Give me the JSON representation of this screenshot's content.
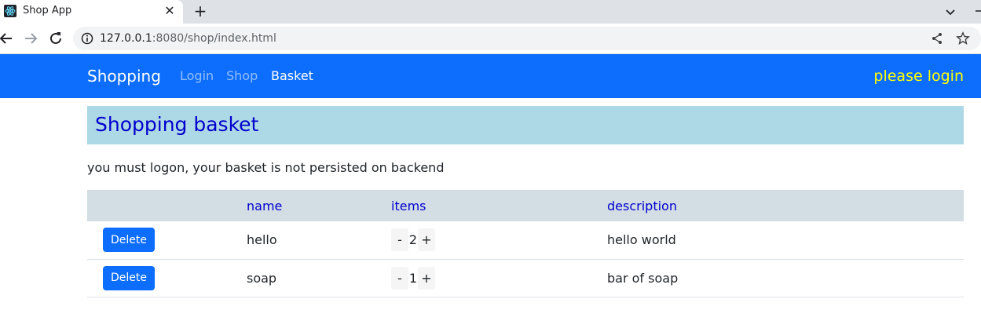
{
  "browser": {
    "tab_title": "Shop App",
    "tab_close": "✕",
    "new_tab": "+",
    "url_host": "127.0.0.1",
    "url_rest": ":8080/shop/index.html"
  },
  "navbar": {
    "brand": "Shopping",
    "links": [
      "Login",
      "Shop",
      "Basket"
    ],
    "status": "please login"
  },
  "page": {
    "title": "Shopping basket",
    "notice": "you must logon, your basket is not persisted on backend"
  },
  "table": {
    "headers": [
      "",
      "name",
      "items",
      "description"
    ],
    "rows": [
      {
        "action": "Delete",
        "name": "hello",
        "minus": "-",
        "items": "2",
        "plus": "+",
        "description": "hello world"
      },
      {
        "action": "Delete",
        "name": "soap",
        "minus": "-",
        "items": "1",
        "plus": "+",
        "description": "bar of soap"
      }
    ]
  },
  "colors": {
    "navbar": "#0d6efd",
    "status": "#ffff00",
    "header_bg": "#add8e6",
    "title": "#0000cd"
  }
}
